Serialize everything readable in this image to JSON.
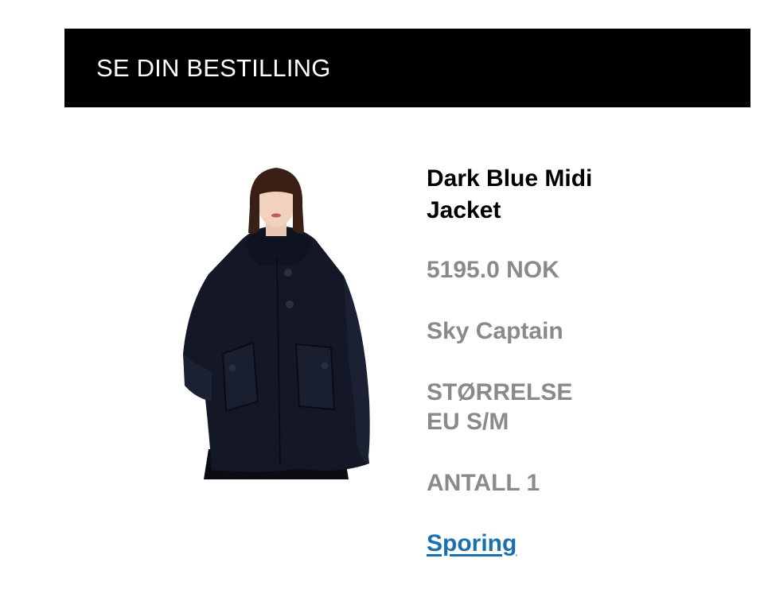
{
  "header": {
    "title": "SE DIN BESTILLING"
  },
  "product": {
    "name": "Dark Blue Midi Jacket",
    "price": "5195.0 NOK",
    "color": "Sky Captain",
    "size_label": "STØRRELSE",
    "size_value": "EU S/M",
    "quantity": "ANTALL 1",
    "tracking_link": "Sporing"
  },
  "colors": {
    "header_bg": "#000000",
    "header_text": "#ffffff",
    "name_text": "#000000",
    "detail_text": "#8a8a8a",
    "link": "#1a6fae",
    "jacket": "#141826"
  }
}
